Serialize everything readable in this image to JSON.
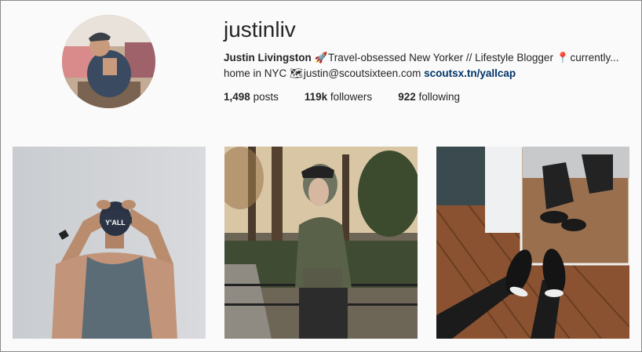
{
  "profile": {
    "username": "justinliv",
    "full_name": "Justin Livingston",
    "bio_emoji_rocket": "🚀",
    "bio_text_1": "Travel-obsessed New Yorker // Lifestyle Blogger",
    "bio_emoji_pin": "📍",
    "bio_text_2": "currently...",
    "bio_text_3": "home in NYC",
    "bio_emoji_map": "🗺",
    "email": "justin@scoutsixteen.com",
    "link": "scoutsx.tn/yallcap"
  },
  "stats": {
    "posts_count": "1,498",
    "posts_label": "posts",
    "followers_count": "119k",
    "followers_label": "followers",
    "following_count": "922",
    "following_label": "following"
  },
  "posts": [
    {
      "cap_text": "Y'ALL"
    },
    {},
    {}
  ],
  "colors": {
    "background": "#fafafa",
    "text": "#262626",
    "link": "#003569"
  }
}
